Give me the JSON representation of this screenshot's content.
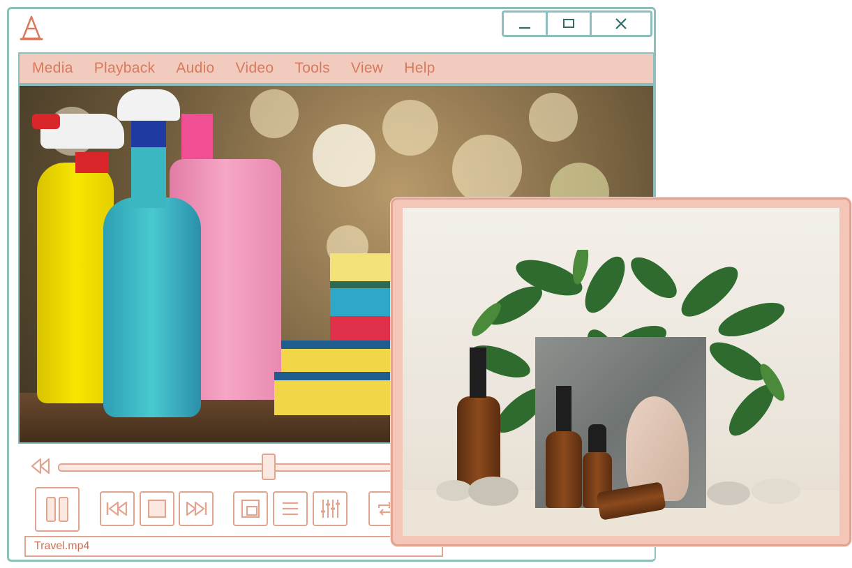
{
  "menu": {
    "items": [
      "Media",
      "Playback",
      "Audio",
      "Video",
      "Tools",
      "View",
      "Help"
    ]
  },
  "window_controls": {
    "minimize_icon": "minimize-icon",
    "maximize_icon": "maximize-icon",
    "close_icon": "close-icon"
  },
  "player": {
    "seek_position": 0.5,
    "status_text": "Travel.mp4"
  },
  "colors": {
    "accent_peach": "#e0a48f",
    "menu_bg": "#f2cbbf",
    "menu_text": "#d9795b",
    "frame_teal": "#8bbfbd"
  },
  "icons": {
    "controls": [
      "rewind-icon",
      "pause-icon",
      "previous-icon",
      "stop-icon",
      "next-icon",
      "fullscreen-icon",
      "playlist-icon",
      "equalizer-icon",
      "loop-icon"
    ]
  }
}
